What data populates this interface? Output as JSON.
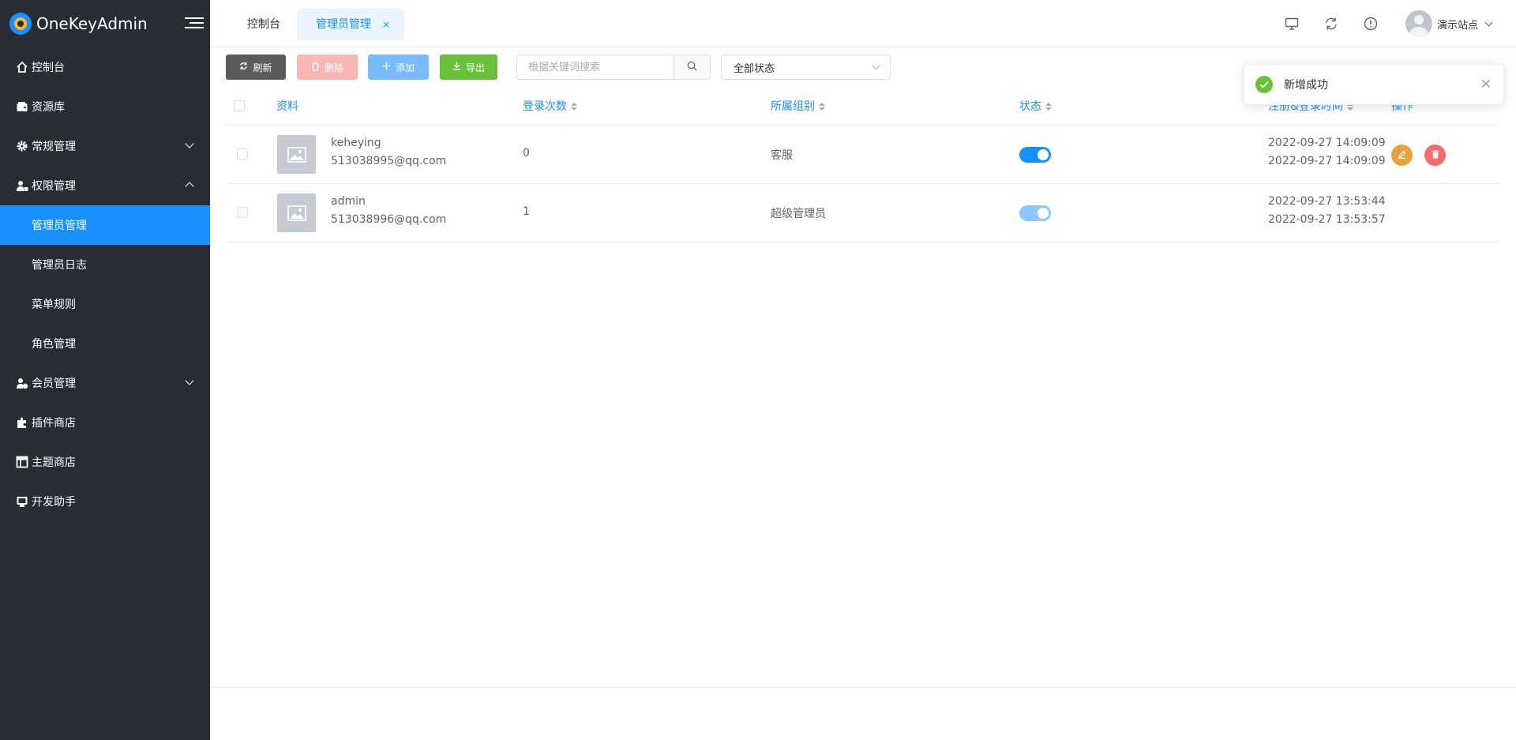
{
  "app": {
    "title": "OneKeyAdmin"
  },
  "sidebar": {
    "items": [
      {
        "label": "控制台",
        "icon": "home-icon"
      },
      {
        "label": "资源库",
        "icon": "wallet-icon"
      },
      {
        "label": "常规管理",
        "icon": "gear-icon",
        "expanded": false
      },
      {
        "label": "权限管理",
        "icon": "user-lock-icon",
        "expanded": true
      },
      {
        "label": "会员管理",
        "icon": "user-check-icon",
        "expanded": false
      },
      {
        "label": "插件商店",
        "icon": "puzzle-icon"
      },
      {
        "label": "主题商店",
        "icon": "layout-icon"
      },
      {
        "label": "开发助手",
        "icon": "dev-icon"
      }
    ],
    "sub_items": [
      {
        "label": "管理员管理",
        "active": true
      },
      {
        "label": "管理员日志"
      },
      {
        "label": "菜单规则"
      },
      {
        "label": "角色管理"
      }
    ]
  },
  "header": {
    "tabs": [
      {
        "label": "控制台"
      },
      {
        "label": "管理员管理",
        "active": true,
        "close": "×"
      }
    ],
    "user_name": "演示站点"
  },
  "toolbar": {
    "refresh": "刷新",
    "delete": "删除",
    "add": "添加",
    "export": "导出",
    "search_placeholder": "根据关键词搜索",
    "status_select": "全部状态"
  },
  "table": {
    "headers": {
      "profile": "资料",
      "login_count": "登录次数",
      "group": "所属组别",
      "status": "状态",
      "time": "注册&登录时间",
      "actions": "操作"
    },
    "rows": [
      {
        "name": "keheying",
        "email": "513038995@qq.com",
        "login_count": "0",
        "group": "客服",
        "status": true,
        "registered": "2022-09-27 14:09:09",
        "last_login": "2022-09-27 14:09:09",
        "editable": true
      },
      {
        "name": "admin",
        "email": "513038996@qq.com",
        "login_count": "1",
        "group": "超级管理员",
        "status": true,
        "registered": "2022-09-27 13:53:44",
        "last_login": "2022-09-27 13:53:57",
        "editable": false
      }
    ]
  },
  "notification": {
    "text": "新增成功",
    "type": "success"
  },
  "colors": {
    "sidebar_bg": "#282c34",
    "primary": "#1890ff",
    "success": "#67c23a",
    "warning": "#e6a23c",
    "danger": "#f56c6c"
  }
}
